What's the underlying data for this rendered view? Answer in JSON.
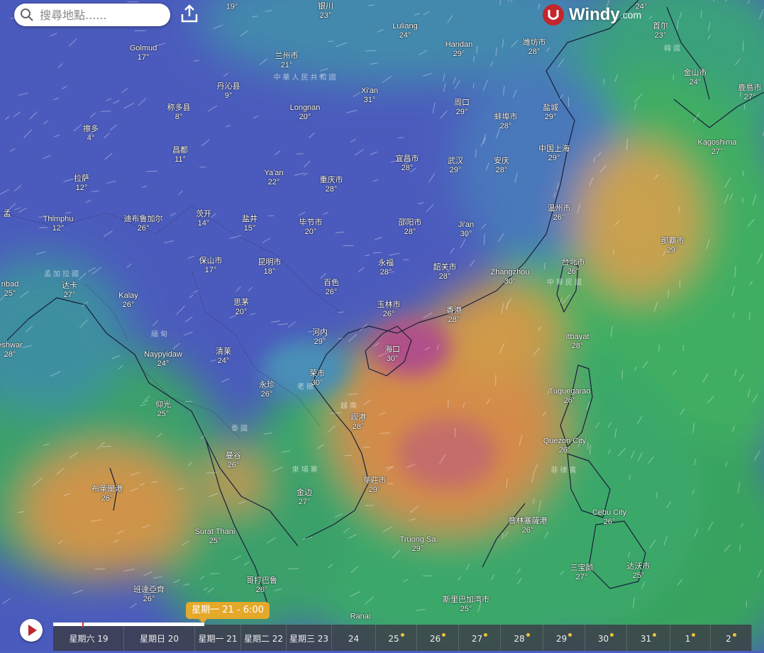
{
  "search": {
    "placeholder": "搜尋地點......"
  },
  "logo": {
    "brand": "Windy",
    "domain": ".com"
  },
  "timeline": {
    "current": "星期一 21 - 6:00",
    "days": [
      "星期六 19",
      "星期日 20",
      "星期一 21",
      "星期二 22",
      "星期三 23",
      "24",
      "25",
      "26",
      "27",
      "28",
      "29",
      "30",
      "31",
      "1",
      "2"
    ]
  },
  "regions": [
    "中華人民共和國",
    "韓國",
    "中華民國",
    "孟加拉國",
    "緬甸",
    "老撾",
    "越南",
    "泰國",
    "柬埔寨",
    "菲律賓"
  ],
  "cities": [
    {
      "name": "Golmud",
      "temp": "17°"
    },
    {
      "name": "兰州市",
      "temp": "21°"
    },
    {
      "name": "丹沁县",
      "temp": "9°"
    },
    {
      "name": "称多县",
      "temp": "8°"
    },
    {
      "name": "擦多",
      "temp": "4°"
    },
    {
      "name": "昌都",
      "temp": "11°"
    },
    {
      "name": "拉萨",
      "temp": "12°"
    },
    {
      "name": "Thimphu",
      "temp": "12°"
    },
    {
      "name": "迪布鲁加尔",
      "temp": "26°"
    },
    {
      "name": "茨开",
      "temp": "14°"
    },
    {
      "name": "盐井",
      "temp": "15°"
    },
    {
      "name": "Ya'an",
      "temp": "22°"
    },
    {
      "name": "Longnan",
      "temp": "20°"
    },
    {
      "name": "Xi'an",
      "temp": "31°"
    },
    {
      "name": "Luliang",
      "temp": "24°"
    },
    {
      "name": "Handan",
      "temp": "29°"
    },
    {
      "name": "银川",
      "temp": "23°"
    },
    {
      "name": "潍坊市",
      "temp": "28°"
    },
    {
      "name": "首尔",
      "temp": "23°"
    },
    {
      "name": "金山市",
      "temp": "24°"
    },
    {
      "name": "鹿島市",
      "temp": "27°"
    },
    {
      "name": "Kagoshima",
      "temp": "27°"
    },
    {
      "name": "周口",
      "temp": "29°"
    },
    {
      "name": "蚌埠市",
      "temp": "28°"
    },
    {
      "name": "盐城",
      "temp": "29°"
    },
    {
      "name": "中国上海",
      "temp": "29°"
    },
    {
      "name": "宜昌市",
      "temp": "28°"
    },
    {
      "name": "武汉",
      "temp": "29°"
    },
    {
      "name": "安庆",
      "temp": "28°"
    },
    {
      "name": "重庆市",
      "temp": "28°"
    },
    {
      "name": "毕节市",
      "temp": "20°"
    },
    {
      "name": "邵阳市",
      "temp": "28°"
    },
    {
      "name": "Ji'an",
      "temp": "30°"
    },
    {
      "name": "温州市",
      "temp": "26°"
    },
    {
      "name": "那覇市",
      "temp": "29°"
    },
    {
      "name": "保山市",
      "temp": "17°"
    },
    {
      "name": "昆明市",
      "temp": "18°"
    },
    {
      "name": "永福",
      "temp": "28°"
    },
    {
      "name": "韶关市",
      "temp": "28°"
    },
    {
      "name": "Zhangzhou",
      "temp": "30°"
    },
    {
      "name": "台北市",
      "temp": "26°"
    },
    {
      "name": "百色",
      "temp": "26°"
    },
    {
      "name": "玉林市",
      "temp": "26°"
    },
    {
      "name": "香港",
      "temp": "28°"
    },
    {
      "name": "Kalay",
      "temp": "26°"
    },
    {
      "name": "达卡",
      "temp": "27°"
    },
    {
      "name": "nbad",
      "temp": "25°"
    },
    {
      "name": "思茅",
      "temp": "20°"
    },
    {
      "name": "河内",
      "temp": "29°"
    },
    {
      "name": "海口",
      "temp": "30°"
    },
    {
      "name": "Itbayat",
      "temp": "28°"
    },
    {
      "name": "eshwar",
      "temp": "28°"
    },
    {
      "name": "Naypyidaw",
      "temp": "24°"
    },
    {
      "name": "清莱",
      "temp": "24°"
    },
    {
      "name": "荣市",
      "temp": "30°"
    },
    {
      "name": "永珍",
      "temp": "26°"
    },
    {
      "name": "仰光",
      "temp": "25°"
    },
    {
      "name": "岘港",
      "temp": "28°"
    },
    {
      "name": "Tuguegarao",
      "temp": "26°"
    },
    {
      "name": "Quezon City",
      "temp": "26°"
    },
    {
      "name": "曼谷",
      "temp": "26°"
    },
    {
      "name": "布萊爾港",
      "temp": "26°"
    },
    {
      "name": "芽莊市",
      "temp": "29°"
    },
    {
      "name": "金边",
      "temp": "27°"
    },
    {
      "name": "Cebu City",
      "temp": "26°"
    },
    {
      "name": "普林塞薩港",
      "temp": "26°"
    },
    {
      "name": "Surat Thani",
      "temp": "25°"
    },
    {
      "name": "Truong Sa",
      "temp": "29°"
    },
    {
      "name": "三宝颜",
      "temp": "27°"
    },
    {
      "name": "达沃市",
      "temp": "25°"
    },
    {
      "name": "哥打巴鲁",
      "temp": "26°"
    },
    {
      "name": "班達亞齊",
      "temp": "26°"
    },
    {
      "name": "斯里巴加湾市",
      "temp": "25°"
    },
    {
      "name": "Ranai",
      "temp": ""
    },
    {
      "name": "19°",
      "temp": ""
    },
    {
      "name": "24°",
      "temp": ""
    },
    {
      "name": "孟",
      "temp": ""
    }
  ]
}
